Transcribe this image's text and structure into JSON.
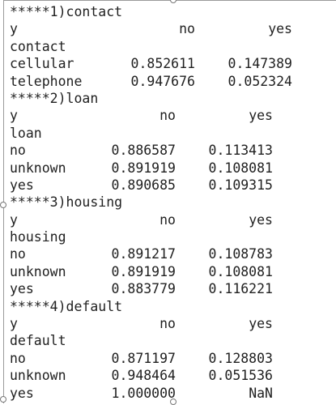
{
  "sections": [
    {
      "header": "*****1)contact",
      "col_label": "y",
      "col_no": "no",
      "col_yes": "yes",
      "index_name": "contact",
      "rows": [
        {
          "label": "cellular",
          "no": "0.852611",
          "yes": "0.147389"
        },
        {
          "label": "telephone",
          "no": "0.947676",
          "yes": "0.052324"
        }
      ]
    },
    {
      "header": "*****2)loan",
      "col_label": "y",
      "col_no": "no",
      "col_yes": "yes",
      "index_name": "loan",
      "rows": [
        {
          "label": "no",
          "no": "0.886587",
          "yes": "0.113413"
        },
        {
          "label": "unknown",
          "no": "0.891919",
          "yes": "0.108081"
        },
        {
          "label": "yes",
          "no": "0.890685",
          "yes": "0.109315"
        }
      ]
    },
    {
      "header": "*****3)housing",
      "col_label": "y",
      "col_no": "no",
      "col_yes": "yes",
      "index_name": "housing",
      "rows": [
        {
          "label": "no",
          "no": "0.891217",
          "yes": "0.108783"
        },
        {
          "label": "unknown",
          "no": "0.891919",
          "yes": "0.108081"
        },
        {
          "label": "yes",
          "no": "0.883779",
          "yes": "0.116221"
        }
      ]
    },
    {
      "header": "*****4)default",
      "col_label": "y",
      "col_no": "no",
      "col_yes": "yes",
      "index_name": "default",
      "rows": [
        {
          "label": "no",
          "no": "0.871197",
          "yes": "0.128803"
        },
        {
          "label": "unknown",
          "no": "0.948464",
          "yes": "0.051536"
        },
        {
          "label": "yes",
          "no": "1.000000",
          "yes": "NaN"
        }
      ]
    }
  ]
}
